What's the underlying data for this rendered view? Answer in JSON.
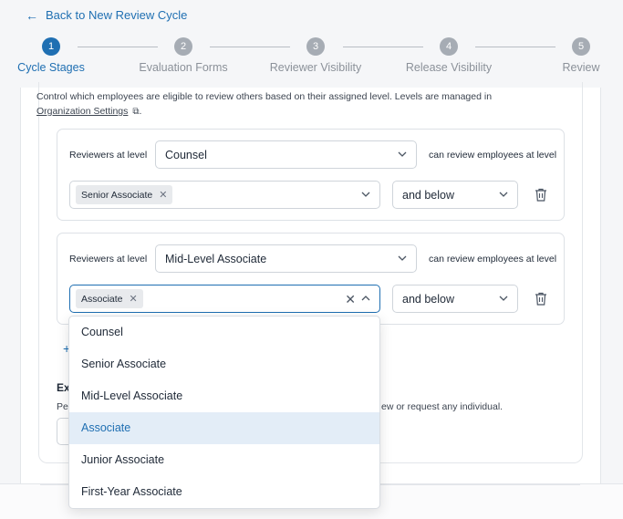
{
  "nav": {
    "back_label": "Back to New Review Cycle"
  },
  "stepper": {
    "steps": [
      {
        "number": "1",
        "label": "Cycle Stages"
      },
      {
        "number": "2",
        "label": "Evaluation Forms"
      },
      {
        "number": "3",
        "label": "Reviewer Visibility"
      },
      {
        "number": "4",
        "label": "Release Visibility"
      },
      {
        "number": "5",
        "label": "Review"
      }
    ],
    "active_index": 0
  },
  "section": {
    "description": "Control which employees are eligible to review others based on their assigned level. Levels are managed in",
    "settings_link": "Organization Settings",
    "period": "."
  },
  "rules": [
    {
      "reviewers_label": "Reviewers at level",
      "reviewer_level": "Counsel",
      "can_review_label": "can review employees at level",
      "target_chip": "Senior Associate",
      "scope": "and below"
    },
    {
      "reviewers_label": "Reviewers at level",
      "reviewer_level": "Mid-Level Associate",
      "can_review_label": "can review employees at level",
      "target_chip": "Associate",
      "scope": "and below"
    }
  ],
  "dropdown": {
    "options": [
      "Counsel",
      "Senior Associate",
      "Mid-Level Associate",
      "Associate",
      "Junior Associate",
      "First-Year Associate"
    ],
    "selected": "Associate"
  },
  "partial": {
    "add_glyph": "+",
    "heading_fragment": "Ex",
    "text_start": "Pe",
    "text_end": "ew or request any individual."
  },
  "colors": {
    "accent": "#1f6fb2",
    "selected_bg": "#e3edf7",
    "step_inactive": "#a6acb4"
  }
}
